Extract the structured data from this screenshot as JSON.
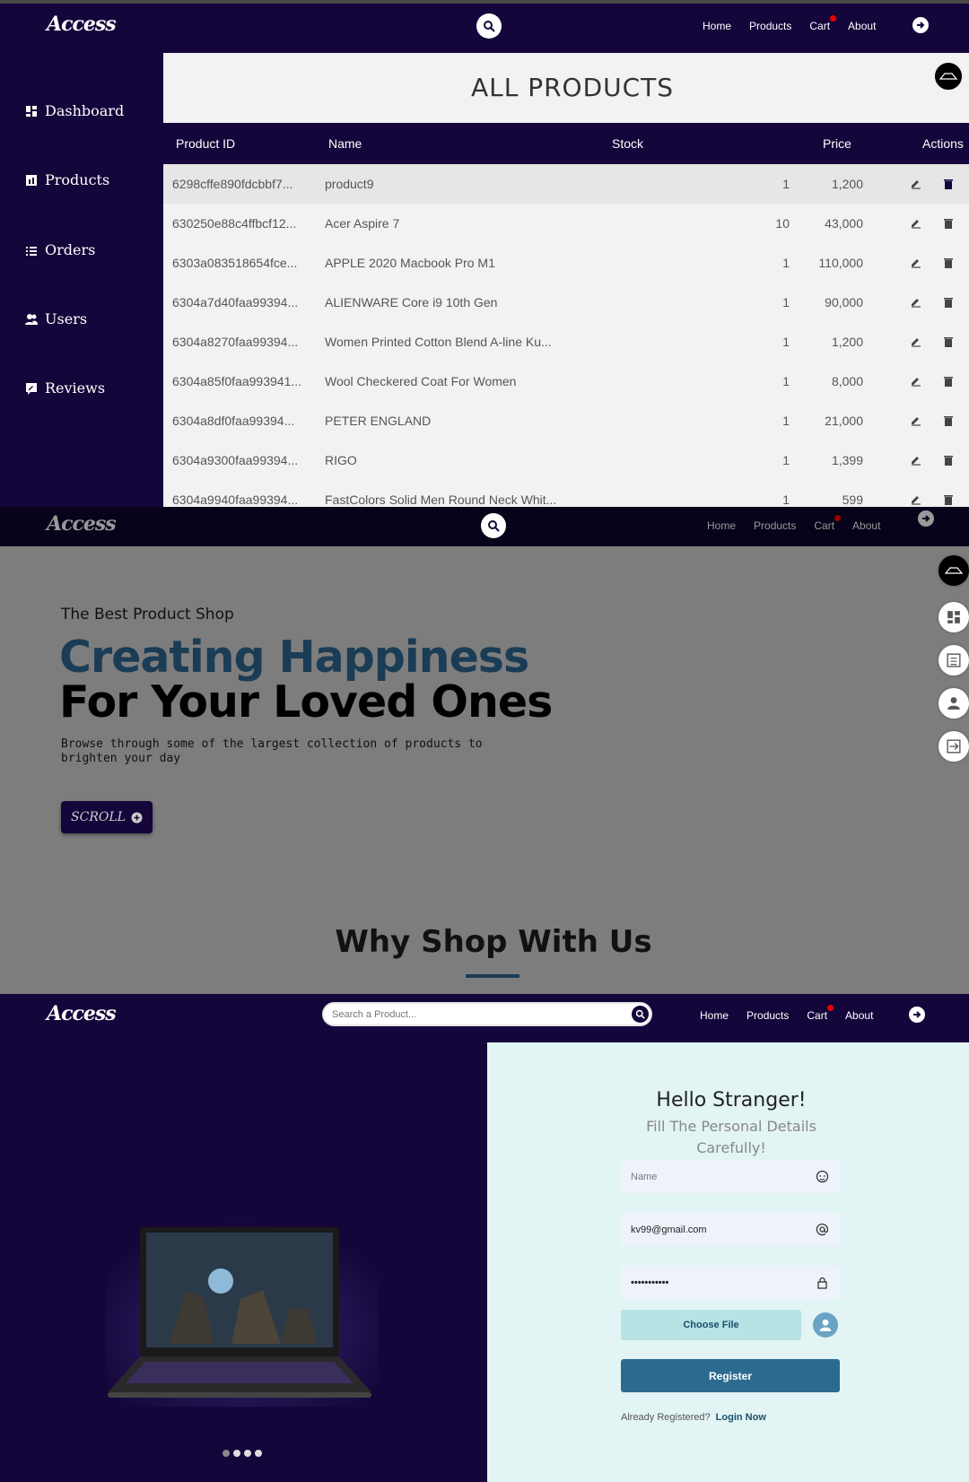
{
  "nav": {
    "logo": "Access",
    "links": [
      "Home",
      "Products",
      "Cart",
      "About"
    ],
    "search_placeholder": "Search a Product..."
  },
  "admin": {
    "sidebar": [
      "Dashboard",
      "Products",
      "Orders",
      "Users",
      "Reviews"
    ],
    "title": "ALL PRODUCTS",
    "columns": [
      "Product ID",
      "Name",
      "Stock",
      "Price",
      "Actions"
    ],
    "rows": [
      {
        "id": "6298cffe890fdcbbf7...",
        "name": "product9",
        "stock": "1",
        "price": "1,200"
      },
      {
        "id": "630250e88c4ffbcf12...",
        "name": "Acer Aspire 7",
        "stock": "10",
        "price": "43,000"
      },
      {
        "id": "6303a083518654fce...",
        "name": "APPLE 2020 Macbook Pro M1",
        "stock": "1",
        "price": "110,000"
      },
      {
        "id": "6304a7d40faa99394...",
        "name": "ALIENWARE Core i9 10th Gen",
        "stock": "1",
        "price": "90,000"
      },
      {
        "id": "6304a8270faa99394...",
        "name": "Women Printed Cotton Blend A-line Ku...",
        "stock": "1",
        "price": "1,200"
      },
      {
        "id": "6304a85f0faa993941...",
        "name": "Wool Checkered Coat For Women",
        "stock": "1",
        "price": "8,000"
      },
      {
        "id": "6304a8df0faa99394...",
        "name": "PETER ENGLAND",
        "stock": "1",
        "price": "21,000"
      },
      {
        "id": "6304a9300faa99394...",
        "name": "RIGO",
        "stock": "1",
        "price": "1,399"
      },
      {
        "id": "6304a9940faa99394...",
        "name": "FastColors Solid Men Round Neck Whit...",
        "stock": "1",
        "price": "599"
      }
    ]
  },
  "hero": {
    "subtitle": "The Best Product Shop",
    "headline1": "Creating Happiness",
    "headline2": "For Your Loved Ones",
    "paragraph": "Browse through some of the largest collection of products to brighten your day",
    "scroll_label": "SCROLL",
    "section_title": "Why Shop With Us"
  },
  "register": {
    "greeting": "Hello Stranger!",
    "instruction": "Fill The Personal Details Carefully!",
    "name_placeholder": "Name",
    "email_value": "kv99@gmail.com",
    "password_value": "•••••••••••",
    "choose_file": "Choose File",
    "submit": "Register",
    "already": "Already Registered?",
    "login_link": "Login Now"
  },
  "colors": {
    "navy": "#14053a",
    "accent": "#2c6b8f",
    "cart_dot": "#e00000"
  }
}
